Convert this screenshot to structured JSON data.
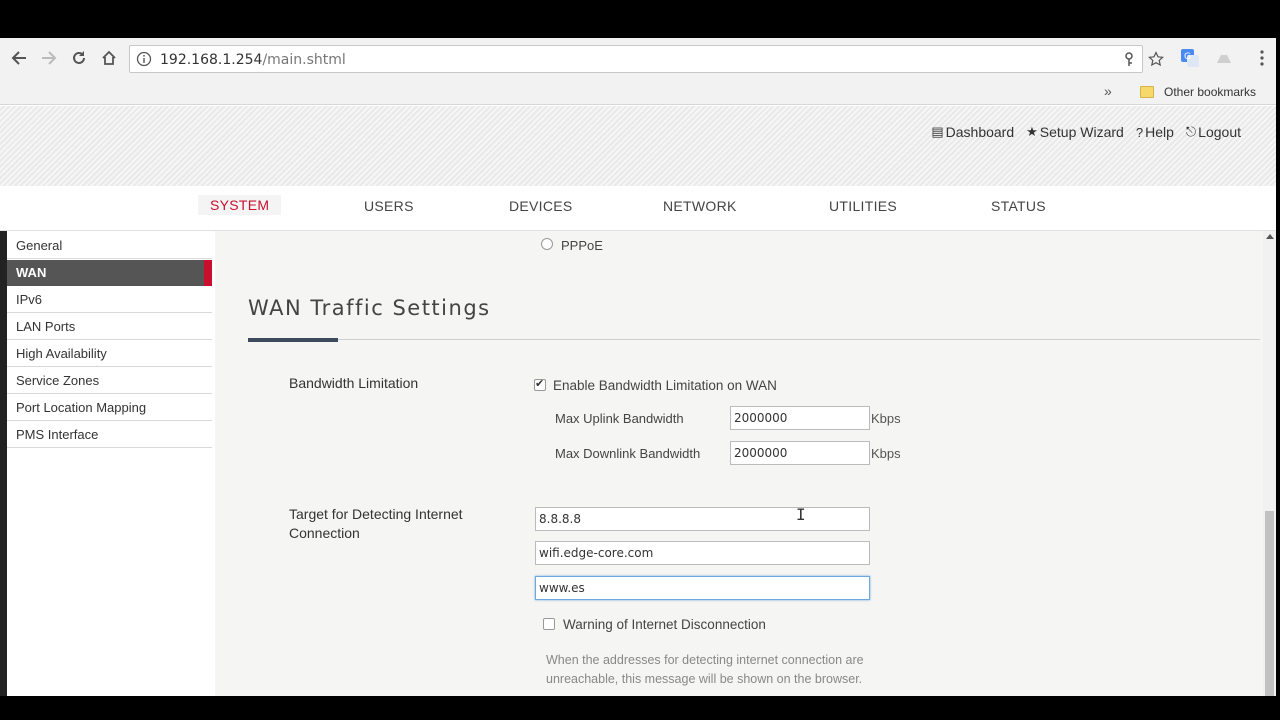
{
  "browser": {
    "url_host": "192.168.1.254",
    "url_path": "/main.shtml",
    "bookmarks_overflow": "»",
    "other_bookmarks": "Other bookmarks"
  },
  "header": {
    "links": [
      "Dashboard",
      "Setup Wizard",
      "Help",
      "Logout"
    ]
  },
  "menu": {
    "items": [
      "SYSTEM",
      "USERS",
      "DEVICES",
      "NETWORK",
      "UTILITIES",
      "STATUS"
    ],
    "active": "SYSTEM"
  },
  "sidebar": {
    "items": [
      "General",
      "WAN",
      "IPv6",
      "LAN Ports",
      "High Availability",
      "Service Zones",
      "Port Location Mapping",
      "PMS Interface"
    ],
    "active": "WAN"
  },
  "content": {
    "pppoe_label": "PPPoE",
    "section_title": "WAN Traffic Settings",
    "bandwidth_label": "Bandwidth Limitation",
    "enable_bandwidth_label": "Enable Bandwidth Limitation on WAN",
    "enable_bandwidth_checked": true,
    "uplink_label": "Max Uplink Bandwidth",
    "uplink_value": "2000000",
    "downlink_label": "Max Downlink Bandwidth",
    "downlink_value": "2000000",
    "unit": "Kbps",
    "target_label": "Target for Detecting Internet Connection",
    "target_1": "8.8.8.8",
    "target_2": "wifi.edge-core.com",
    "target_3": "www.es",
    "warning_label": "Warning of Internet Disconnection",
    "warning_checked": false,
    "hint": "When the addresses for detecting internet connection are unreachable, this message will be shown on the browser."
  },
  "colors": {
    "accent_red": "#c8102e",
    "section_accent": "#3d4a5c"
  }
}
